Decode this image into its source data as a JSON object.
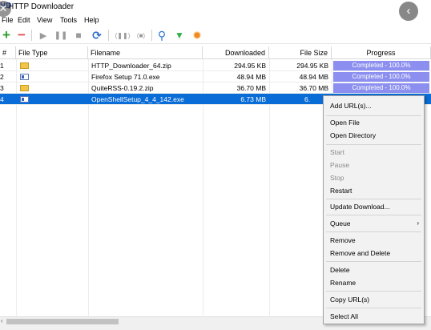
{
  "window": {
    "app_icon": "HD",
    "title": "HTTP Downloader",
    "overlay_close": "✕",
    "back_button": "‹"
  },
  "menu": [
    "File",
    "Edit",
    "View",
    "Tools",
    "Help"
  ],
  "toolbar": [
    {
      "icon": "add-icon",
      "glyph": "+",
      "color": "#2e9e2e"
    },
    {
      "icon": "remove-icon",
      "glyph": "−",
      "color": "#e25050"
    },
    {
      "icon": "start-icon",
      "glyph": "▶",
      "color": "#9a9a9a"
    },
    {
      "icon": "pause-icon",
      "glyph": "❚❚",
      "color": "#9a9a9a"
    },
    {
      "icon": "stop-icon",
      "glyph": "■",
      "color": "#9a9a9a"
    },
    {
      "icon": "restart-icon",
      "glyph": "⟳",
      "color": "#2f6ec8"
    },
    {
      "icon": "pause-active-icon",
      "glyph": "(❚❚)",
      "color": "#9a9a9a"
    },
    {
      "icon": "stop-all-icon",
      "glyph": "(■)",
      "color": "#9a9a9a"
    },
    {
      "icon": "search-icon",
      "glyph": "⚲",
      "color": "#2c74d6"
    },
    {
      "icon": "filter-icon",
      "glyph": "▼",
      "color": "#33b04b"
    },
    {
      "icon": "settings-icon",
      "glyph": "✹",
      "color": "#f08a1c"
    }
  ],
  "columns": {
    "num": "#",
    "file_type": "File Type",
    "filename": "Filename",
    "downloaded": "Downloaded",
    "file_size": "File Size",
    "progress": "Progress"
  },
  "rows": [
    {
      "num": "1",
      "type": "zip",
      "filename": "HTTP_Downloader_64.zip",
      "downloaded": "294.95 KB",
      "size": "294.95 KB",
      "progress": "Completed - 100.0%",
      "selected": false
    },
    {
      "num": "2",
      "type": "exe",
      "filename": "Firefox Setup 71.0.exe",
      "downloaded": "48.94 MB",
      "size": "48.94 MB",
      "progress": "Completed - 100.0%",
      "selected": false
    },
    {
      "num": "3",
      "type": "zip",
      "filename": "QuiteRSS-0.19.2.zip",
      "downloaded": "36.70 MB",
      "size": "36.70 MB",
      "progress": "Completed - 100.0%",
      "selected": false
    },
    {
      "num": "4",
      "type": "exe",
      "filename": "OpenShellSetup_4_4_142.exe",
      "downloaded": "6.73 MB",
      "size": "6.",
      "progress": "",
      "selected": true
    }
  ],
  "scrollbar": {
    "left_arrow": "‹"
  },
  "context_menu": {
    "add_urls": "Add URL(s)...",
    "open_file": "Open File",
    "open_directory": "Open Directory",
    "start": "Start",
    "pause": "Pause",
    "stop": "Stop",
    "restart": "Restart",
    "update_download": "Update Download...",
    "queue": "Queue",
    "queue_arrow": "›",
    "remove": "Remove",
    "remove_and_delete": "Remove and Delete",
    "delete": "Delete",
    "rename": "Rename",
    "copy_urls": "Copy URL(s)",
    "select_all": "Select All"
  }
}
